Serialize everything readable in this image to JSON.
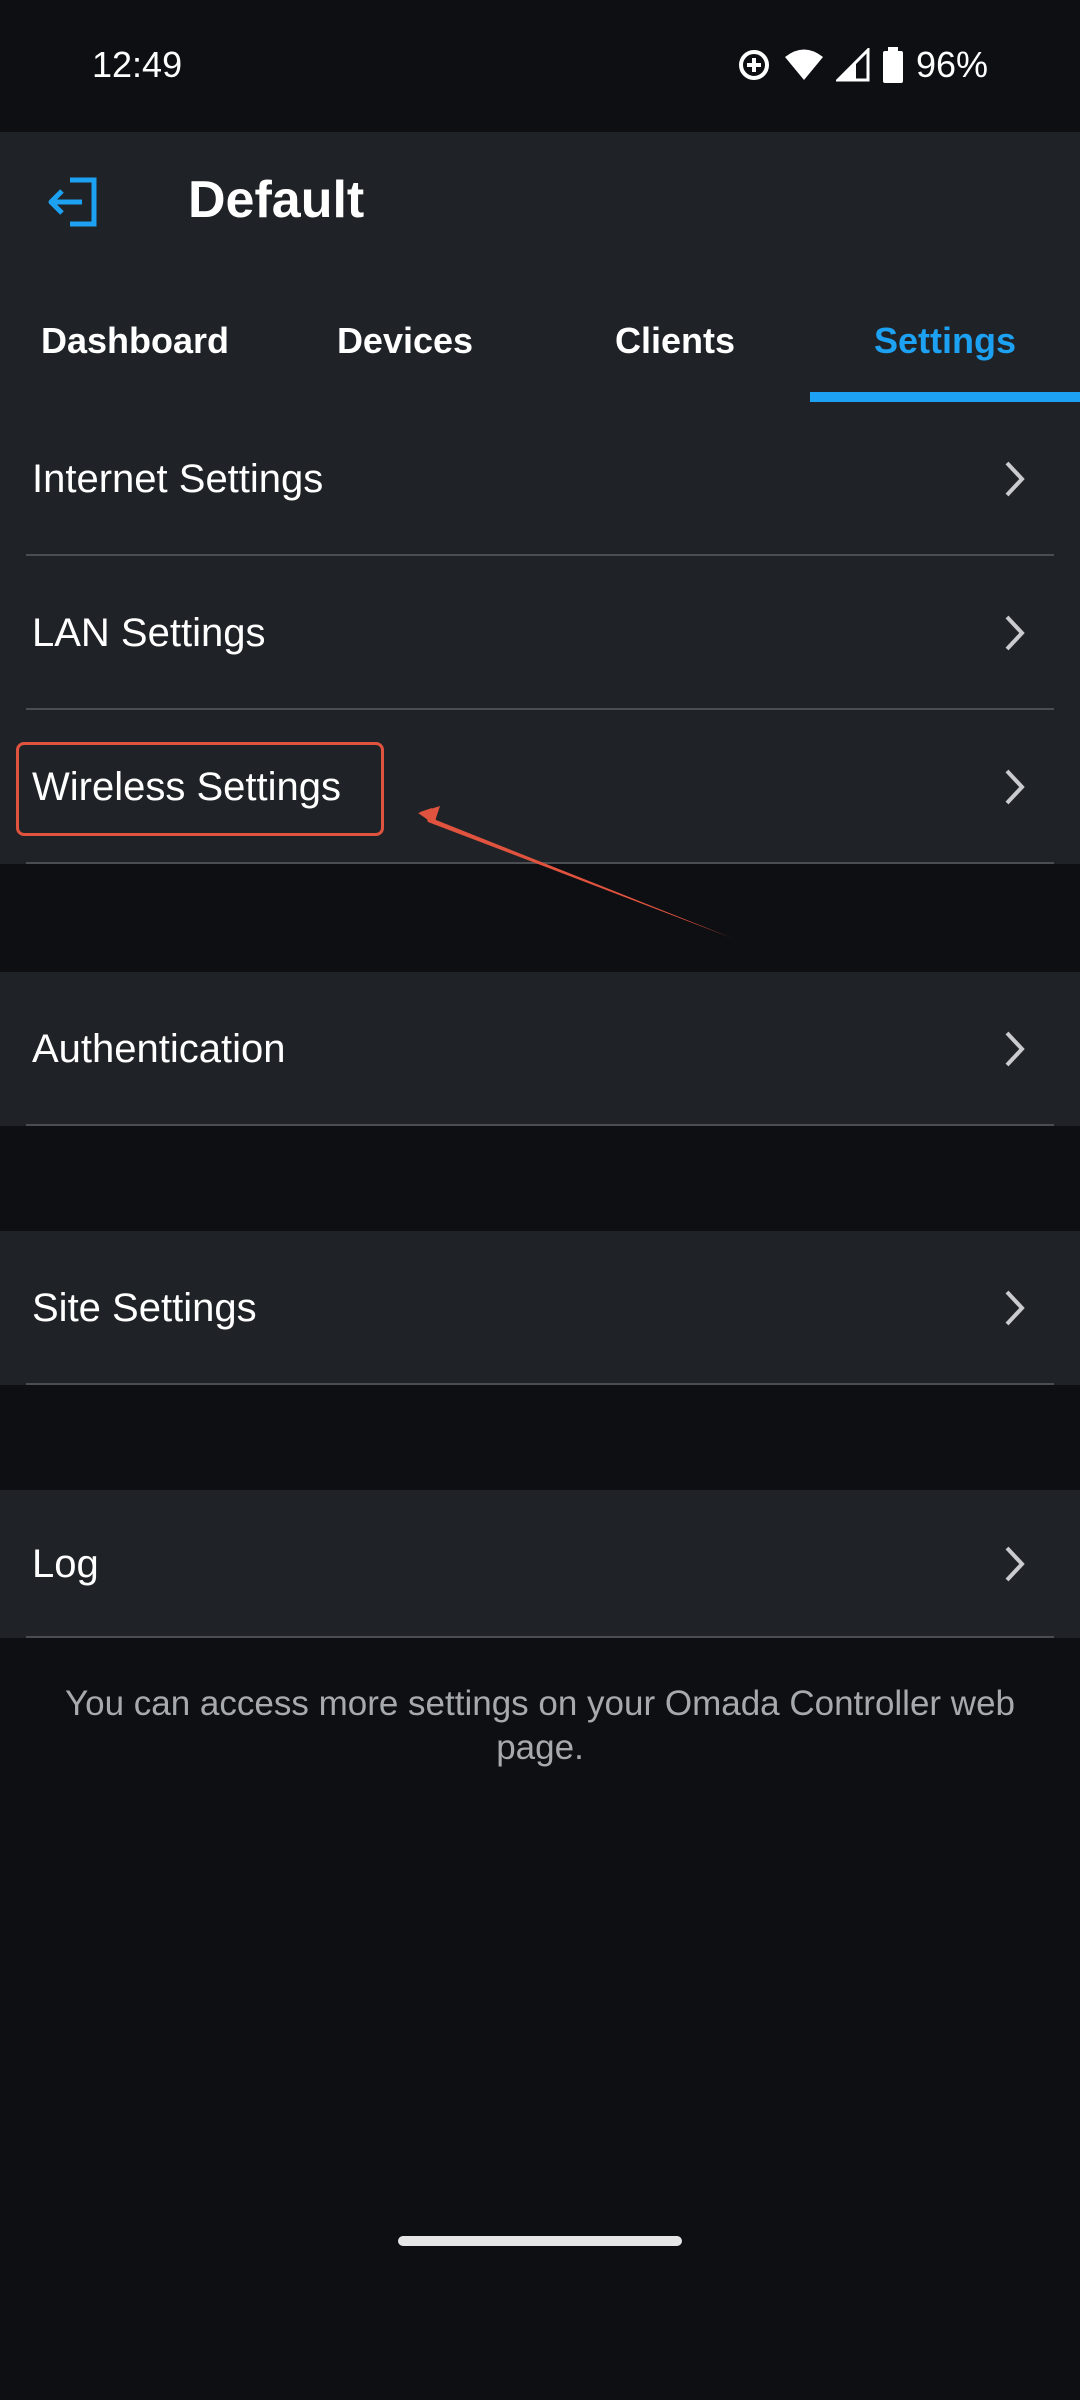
{
  "status_bar": {
    "time": "12:49",
    "battery_percent": "96%"
  },
  "header": {
    "title": "Default",
    "back_icon": "exit-arrow-icon",
    "accent_color": "#1da1f2"
  },
  "tabs": [
    {
      "label": "Dashboard",
      "active": false
    },
    {
      "label": "Devices",
      "active": false
    },
    {
      "label": "Clients",
      "active": false
    },
    {
      "label": "Settings",
      "active": true
    }
  ],
  "settings_items": [
    {
      "label": "Internet Settings"
    },
    {
      "label": "LAN Settings"
    },
    {
      "label": "Wireless Settings"
    },
    {
      "label": "Authentication"
    },
    {
      "label": "Site Settings"
    },
    {
      "label": "Log"
    }
  ],
  "footer": {
    "note": "You can access more settings on your Omada Controller web page."
  },
  "annotation": {
    "highlight_color": "#e0533f",
    "highlighted_item": "Wireless Settings"
  }
}
